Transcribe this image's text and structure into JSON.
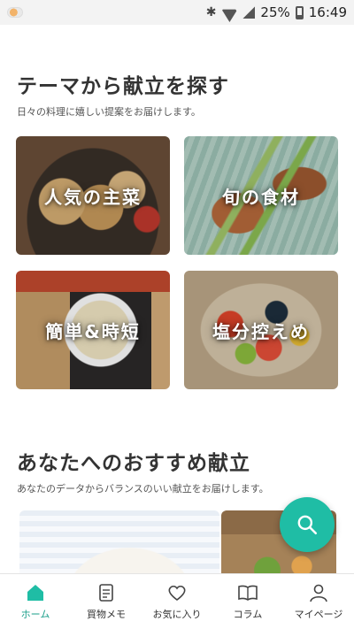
{
  "status_bar": {
    "battery": "25%",
    "time": "16:49"
  },
  "theme_section": {
    "title": "テーマから献立を探す",
    "subtitle": "日々の料理に嬉しい提案をお届けします。",
    "cards": [
      {
        "label": "人気の主菜"
      },
      {
        "label": "旬の食材"
      },
      {
        "label": "簡単&時短"
      },
      {
        "label": "塩分控えめ"
      }
    ]
  },
  "recommend_section": {
    "title": "あなたへのおすすめ献立",
    "subtitle": "あなたのデータからバランスのいい献立をお届けします。"
  },
  "fab": {
    "icon": "search-icon",
    "color": "#1fbda5"
  },
  "bottom_nav": {
    "accent": "#1a9f8a",
    "items": [
      {
        "label": "ホーム",
        "icon": "home-icon",
        "active": true
      },
      {
        "label": "買物メモ",
        "icon": "memo-icon",
        "active": false
      },
      {
        "label": "お気に入り",
        "icon": "heart-icon",
        "active": false
      },
      {
        "label": "コラム",
        "icon": "book-icon",
        "active": false
      },
      {
        "label": "マイページ",
        "icon": "user-icon",
        "active": false
      }
    ]
  }
}
